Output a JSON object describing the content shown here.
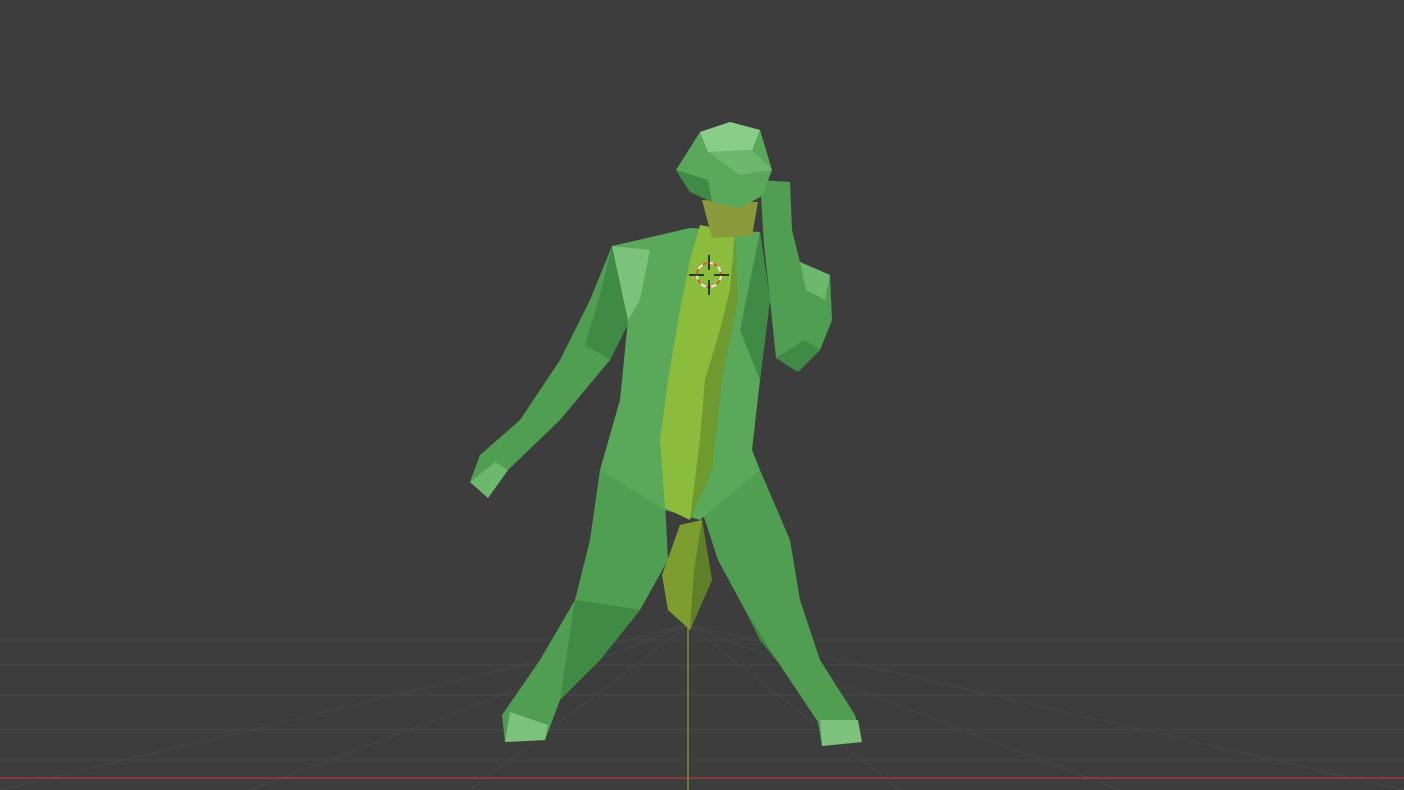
{
  "viewport": {
    "background_color": "#3d3d3d",
    "grid_color": "#484848",
    "x_axis_color": "#9a3a3a",
    "y_axis_color": "#6a9a3a"
  },
  "model": {
    "body_color": "#5aa85a",
    "body_light_color": "#7cc27c",
    "body_dark_color": "#3f8a45",
    "torso_color": "#8cbc3c",
    "torso_dark_color": "#6f9a30"
  },
  "cursor": {
    "icon": "3d-cursor-icon",
    "ring_color_a": "#e8e8e8",
    "ring_color_b": "#d85a3a"
  }
}
